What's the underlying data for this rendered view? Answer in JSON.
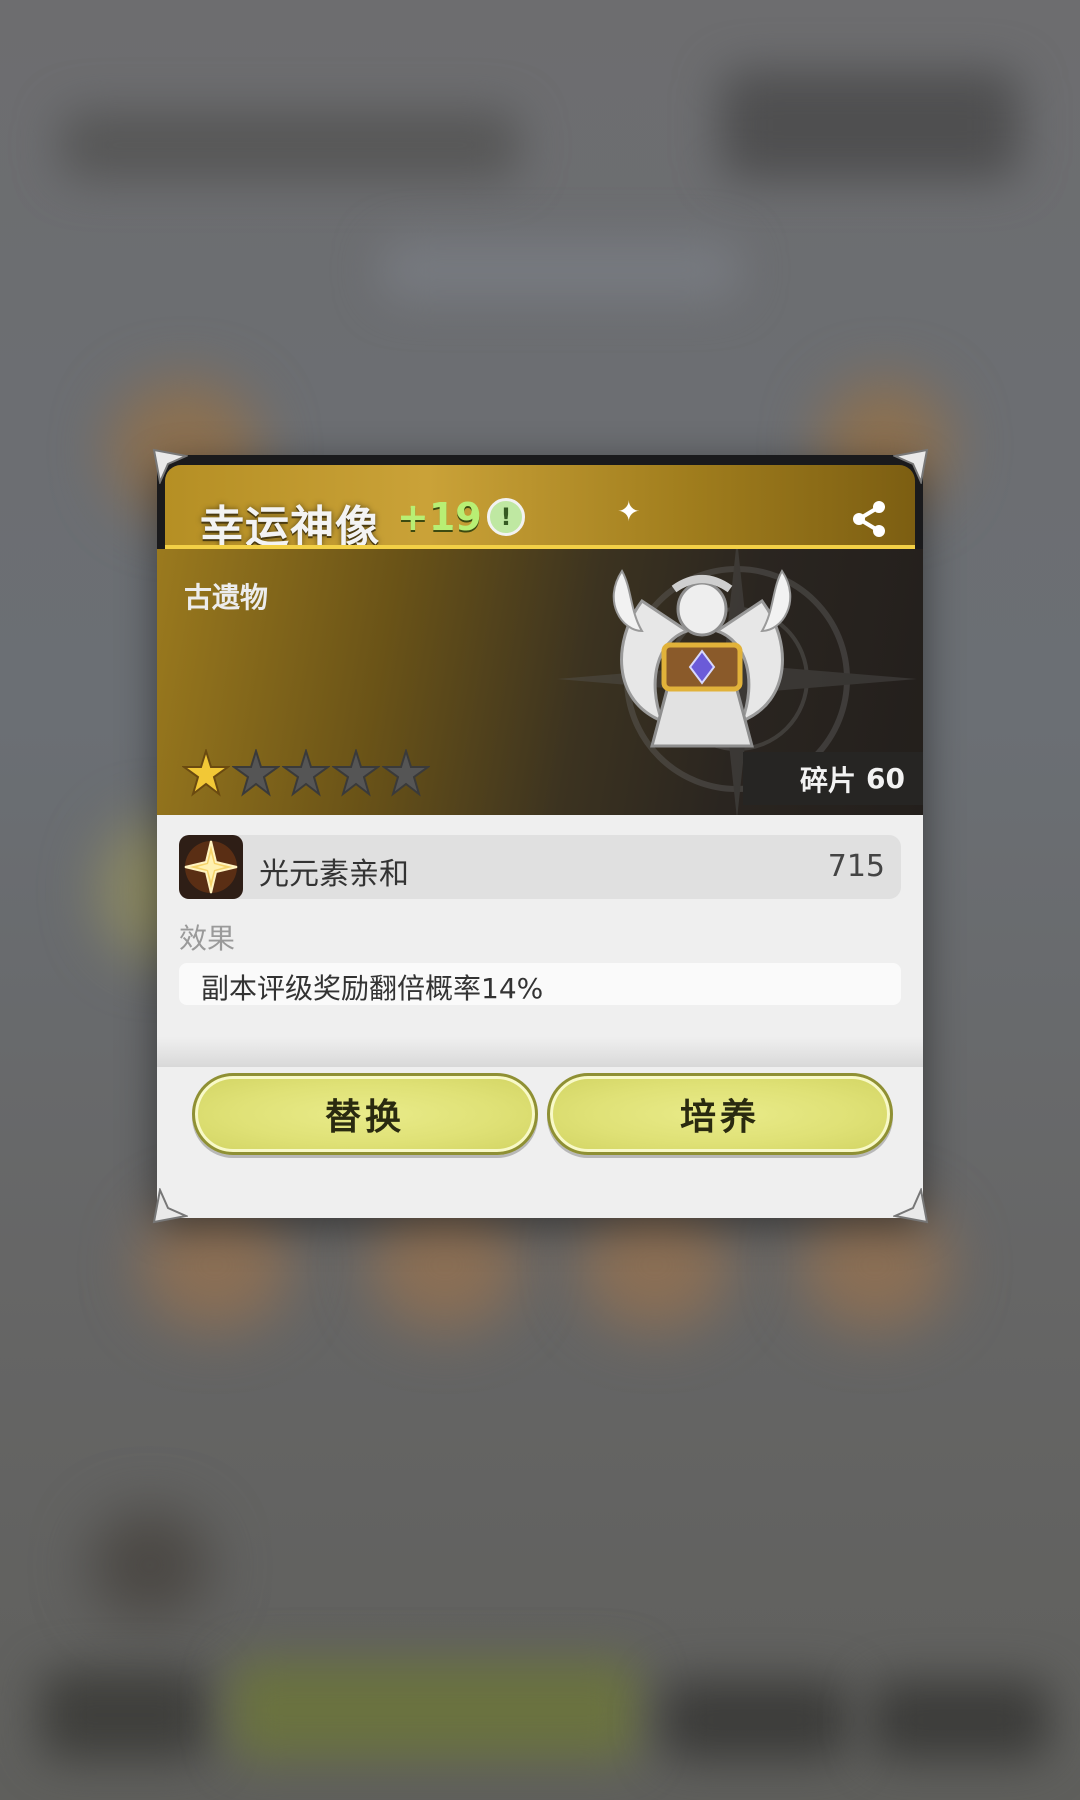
{
  "dialog": {
    "title": "幸运神像",
    "level_suffix": "+19",
    "info_icon": "exclamation-icon",
    "share_icon": "share-icon",
    "category": "古遗物",
    "stars_total": 5,
    "stars_filled": 1,
    "fragments_label": "碎片",
    "fragments_value": "60",
    "affinity": {
      "name": "光元素亲和",
      "value": "715",
      "icon": "light-element-icon"
    },
    "effect_label": "效果",
    "effect_text": "副本评级奖励翻倍概率14%",
    "buttons": {
      "replace": "替换",
      "upgrade": "培养"
    },
    "colors": {
      "title_gold": "#caa238",
      "plus_green": "#b8ef74",
      "button_yellow": "#dfe176"
    }
  }
}
